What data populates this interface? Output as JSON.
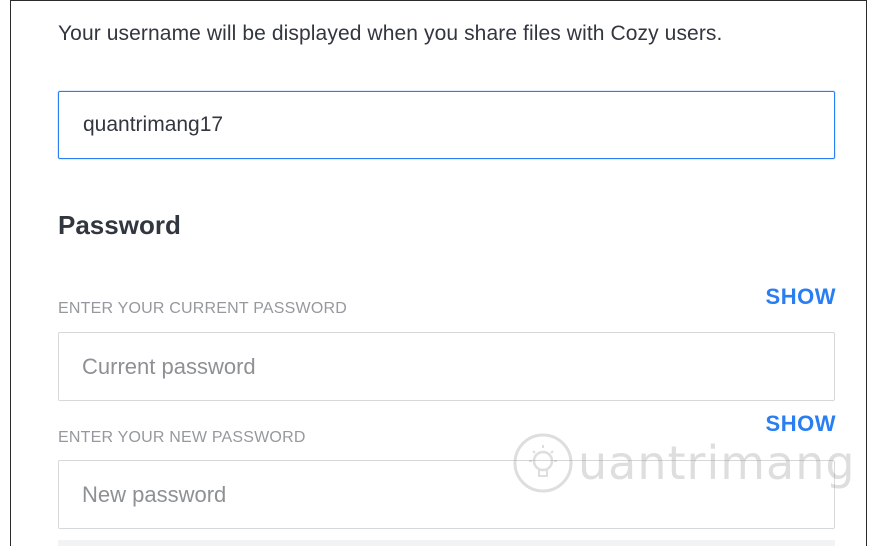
{
  "profile": {
    "username_helper": "Your username will be displayed when you share files with Cozy users.",
    "username_value": "quantrimang17"
  },
  "password": {
    "section_title": "Password",
    "current": {
      "label": "ENTER YOUR CURRENT PASSWORD",
      "placeholder": "Current password",
      "show_label": "SHOW"
    },
    "new": {
      "label": "ENTER YOUR NEW PASSWORD",
      "placeholder": "New password",
      "show_label": "SHOW"
    }
  },
  "watermark": {
    "text": "uantrimang",
    "icon": "lightbulb-icon"
  },
  "colors": {
    "accent": "#297ef2",
    "text": "#32363f",
    "label": "#95999d",
    "border": "#d6d8da"
  }
}
